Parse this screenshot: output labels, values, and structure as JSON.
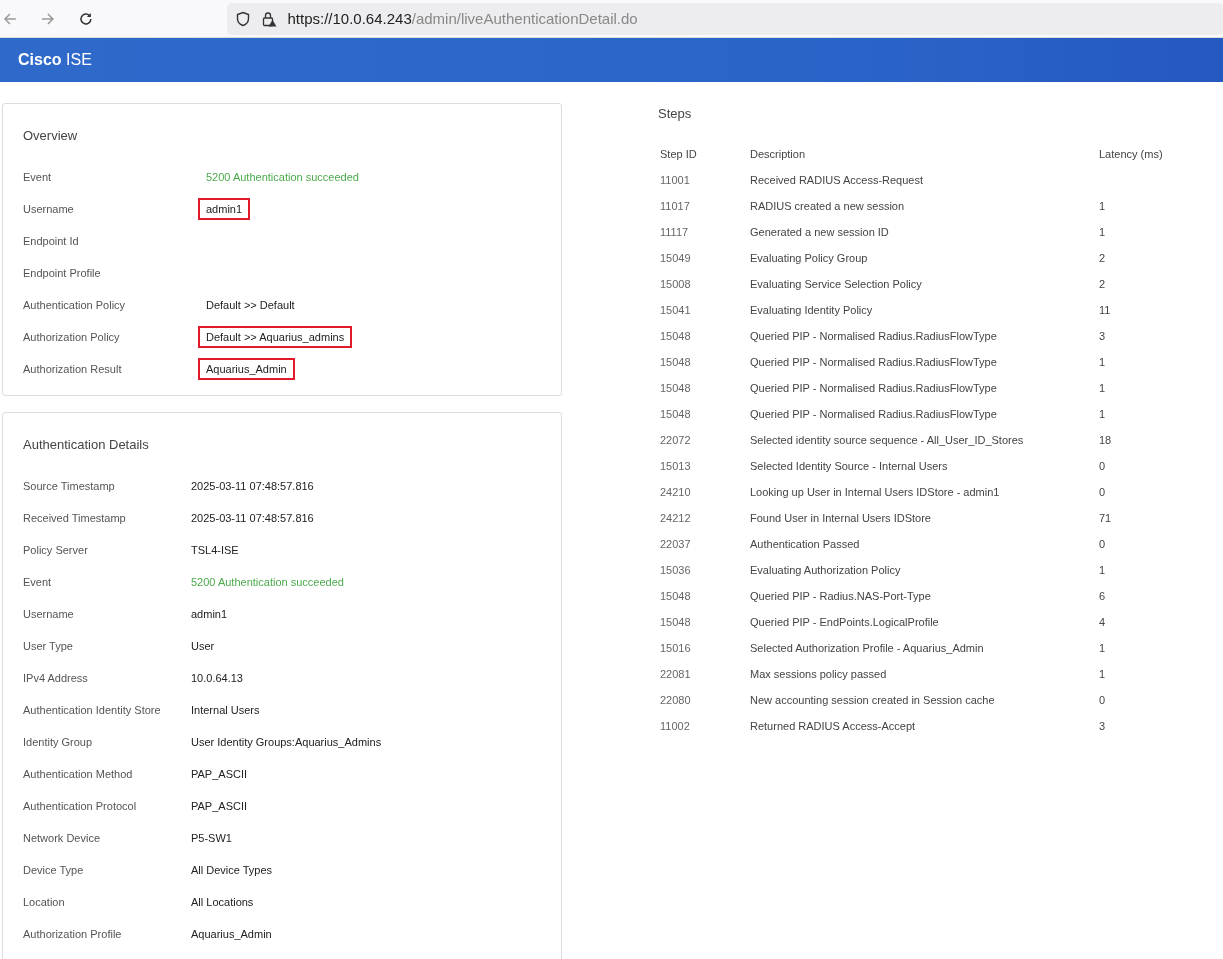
{
  "browser": {
    "url_host": "https://10.0.64.243",
    "url_path": "/admin/liveAuthenticationDetail.do"
  },
  "header": {
    "brand": "Cisco",
    "product": "ISE"
  },
  "overview": {
    "title": "Overview",
    "rows": [
      {
        "label": "Event",
        "value": "5200 Authentication succeeded",
        "kind": "success"
      },
      {
        "label": "Username",
        "value": "admin1",
        "kind": "plain",
        "highlighted": true
      },
      {
        "label": "Endpoint Id"
      },
      {
        "label": "Endpoint Profile"
      },
      {
        "label": "Authentication Policy",
        "value": "Default >> Default",
        "kind": "plain"
      },
      {
        "label": "Authorization Policy",
        "value": "Default >> Aquarius_admins",
        "kind": "plain",
        "highlighted": true
      },
      {
        "label": "Authorization Result",
        "value": "Aquarius_Admin",
        "kind": "plain",
        "highlighted": true
      }
    ]
  },
  "authentication_details": {
    "title": "Authentication Details",
    "rows": [
      {
        "label": "Source Timestamp",
        "value": "2025-03-11 07:48:57.816",
        "kind": "plain"
      },
      {
        "label": "Received Timestamp",
        "value": "2025-03-11 07:48:57.816",
        "kind": "plain"
      },
      {
        "label": "Policy Server",
        "value": "TSL4-ISE",
        "kind": "plain"
      },
      {
        "label": "Event",
        "value": "5200 Authentication succeeded",
        "kind": "success"
      },
      {
        "label": "Username",
        "value": "admin1",
        "kind": "plain"
      },
      {
        "label": "User Type",
        "value": "User",
        "kind": "plain"
      },
      {
        "label": "IPv4 Address",
        "value": "10.0.64.13",
        "kind": "plain"
      },
      {
        "label": "Authentication Identity Store",
        "value": "Internal Users",
        "kind": "plain"
      },
      {
        "label": "Identity Group",
        "value": "User Identity Groups:Aquarius_Admins",
        "kind": "plain"
      },
      {
        "label": "Authentication Method",
        "value": "PAP_ASCII",
        "kind": "plain"
      },
      {
        "label": "Authentication Protocol",
        "value": "PAP_ASCII",
        "kind": "plain"
      },
      {
        "label": "Network Device",
        "value": "P5-SW1",
        "kind": "plain"
      },
      {
        "label": "Device Type",
        "value": "All Device Types",
        "kind": "plain"
      },
      {
        "label": "Location",
        "value": "All Locations",
        "kind": "plain"
      },
      {
        "label": "Authorization Profile",
        "value": "Aquarius_Admin",
        "kind": "plain"
      }
    ]
  },
  "steps": {
    "title": "Steps",
    "columns": [
      "Step ID",
      "Description",
      "Latency (ms)"
    ],
    "rows": [
      [
        "11001",
        "Received RADIUS Access-Request",
        ""
      ],
      [
        "11017",
        "RADIUS created a new session",
        "1"
      ],
      [
        "11117",
        "Generated a new session ID",
        "1"
      ],
      [
        "15049",
        "Evaluating Policy Group",
        "2"
      ],
      [
        "15008",
        "Evaluating Service Selection Policy",
        "2"
      ],
      [
        "15041",
        "Evaluating Identity Policy",
        "11"
      ],
      [
        "15048",
        "Queried PIP - Normalised Radius.RadiusFlowType",
        "3"
      ],
      [
        "15048",
        "Queried PIP - Normalised Radius.RadiusFlowType",
        "1"
      ],
      [
        "15048",
        "Queried PIP - Normalised Radius.RadiusFlowType",
        "1"
      ],
      [
        "15048",
        "Queried PIP - Normalised Radius.RadiusFlowType",
        "1"
      ],
      [
        "22072",
        "Selected identity source sequence - All_User_ID_Stores",
        "18"
      ],
      [
        "15013",
        "Selected Identity Source - Internal Users",
        "0"
      ],
      [
        "24210",
        "Looking up User in Internal Users IDStore - admin1",
        "0"
      ],
      [
        "24212",
        "Found User in Internal Users IDStore",
        "71"
      ],
      [
        "22037",
        "Authentication Passed",
        "0"
      ],
      [
        "15036",
        "Evaluating Authorization Policy",
        "1"
      ],
      [
        "15048",
        "Queried PIP - Radius.NAS-Port-Type",
        "6"
      ],
      [
        "15048",
        "Queried PIP - EndPoints.LogicalProfile",
        "4"
      ],
      [
        "15016",
        "Selected Authorization Profile - Aquarius_Admin",
        "1"
      ],
      [
        "22081",
        "Max sessions policy passed",
        "1"
      ],
      [
        "22080",
        "New accounting session created in Session cache",
        "0"
      ],
      [
        "11002",
        "Returned RADIUS Access-Accept",
        "3"
      ]
    ]
  }
}
